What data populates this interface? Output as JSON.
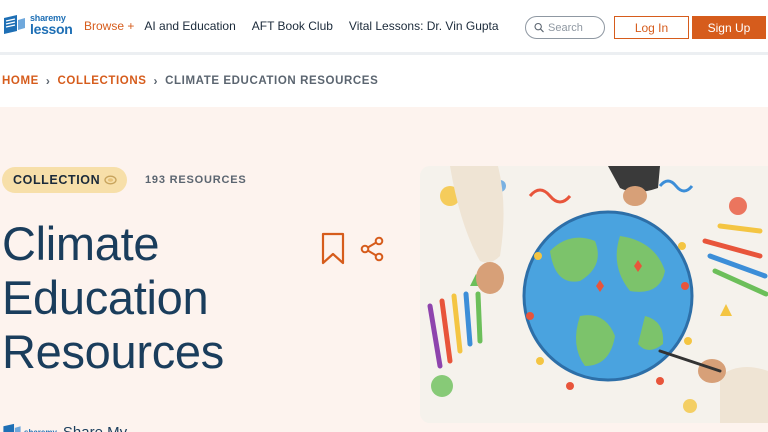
{
  "header": {
    "logo": {
      "line1": "sharemy",
      "line2": "lesson"
    },
    "nav": {
      "browse_label": "Browse +",
      "items": [
        {
          "label": "AI and Education"
        },
        {
          "label": "AFT Book Club"
        },
        {
          "label": "Vital Lessons: Dr. Vin Gupta"
        }
      ]
    },
    "search": {
      "placeholder": "Search"
    },
    "login_label": "Log In",
    "signup_label": "Sign Up"
  },
  "breadcrumb": {
    "items": [
      {
        "label": "HOME"
      },
      {
        "label": "COLLECTIONS"
      }
    ],
    "separator": "›",
    "current": "CLIMATE EDUCATION RESOURCES"
  },
  "hero": {
    "badge_label": "COLLECTION",
    "resource_count": "193 RESOURCES",
    "title_lines": [
      "Climate",
      "Education",
      "Resources"
    ],
    "author": {
      "logo_text": "sharemy",
      "name": "Share My..."
    },
    "icons": {
      "bookmark": "bookmark-icon",
      "share": "share-icon",
      "image": "children-drawing-earth-illustration"
    }
  },
  "colors": {
    "accent": "#d65c1c",
    "title": "#1a3d5c",
    "hero_bg": "#fdf3ee",
    "badge_bg": "#f7dfa9",
    "logo_blue": "#1e6fb5"
  }
}
